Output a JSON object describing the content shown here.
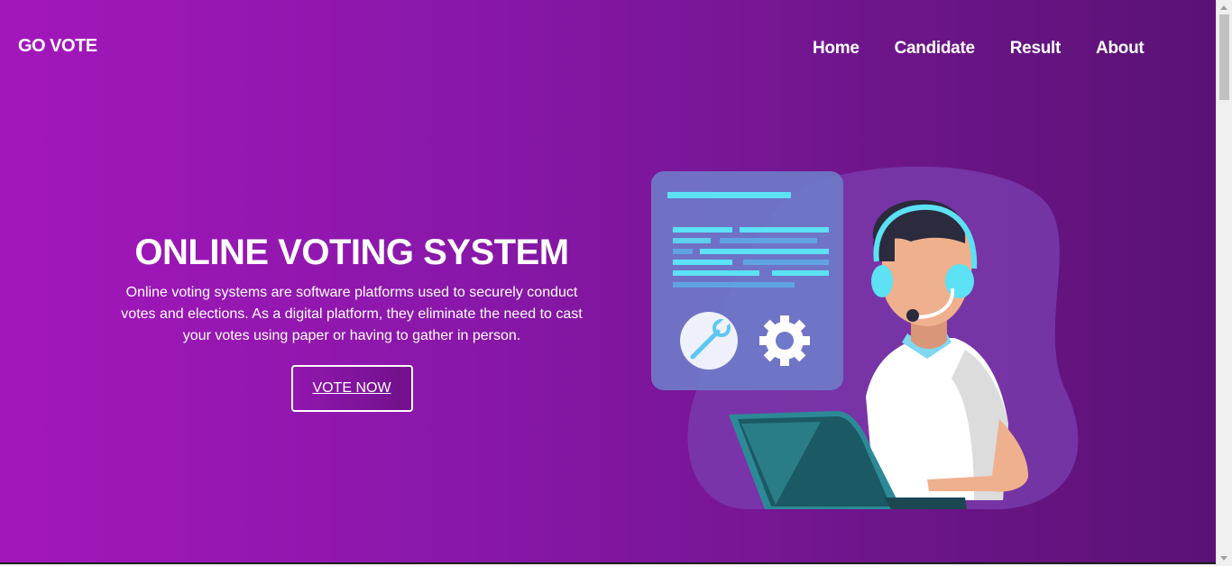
{
  "header": {
    "brand": "GO VOTE",
    "nav": [
      "Home",
      "Candidate",
      "Result",
      "About"
    ]
  },
  "hero": {
    "title": "ONLINE VOTING SYSTEM",
    "description": "Online voting systems are software platforms used to securely conduct votes and elections. As a digital platform, they eliminate the need to cast your votes using paper or having to gather in person.",
    "button_label": "VOTE NOW"
  },
  "illustration": {
    "icons": [
      "document-panel",
      "wrench-icon",
      "gear-icon",
      "headset-agent",
      "laptop"
    ]
  },
  "colors": {
    "gradient_start": "#a317bb",
    "gradient_end": "#5a1275",
    "accent": "#5ce1f5"
  }
}
